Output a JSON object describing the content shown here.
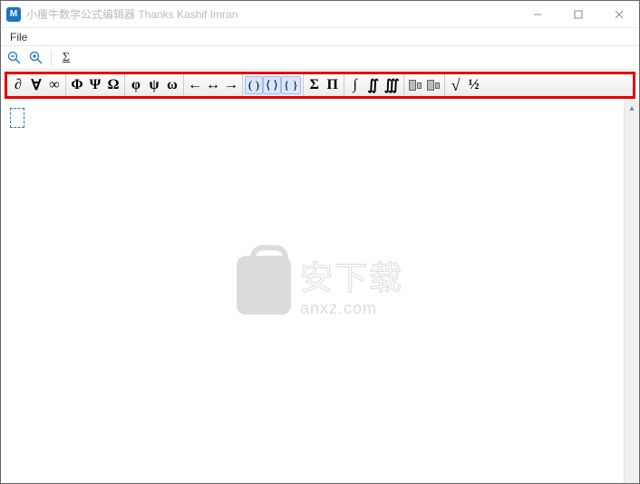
{
  "window": {
    "icon_letter": "M",
    "title": "小痩牛数学公式编辑器 Thanks Kashif Imran"
  },
  "menu": {
    "file": "File"
  },
  "toolbar": {
    "zoom_out": "zoom-out",
    "zoom_in": "zoom-in",
    "sigma_tool": "insert-sigma"
  },
  "symbols": {
    "group1": [
      "∂",
      "∀",
      "∞"
    ],
    "group2": [
      "Φ",
      "Ψ",
      "Ω"
    ],
    "group3": [
      "φ",
      "ψ",
      "ω"
    ],
    "group4": [
      "←",
      "↔",
      "→"
    ],
    "group5": [
      "( )",
      "⟨ ⟩",
      "{ }"
    ],
    "group6": [
      "Σ",
      "Π"
    ],
    "group7": [
      "∫",
      "∬",
      "∭"
    ],
    "group8_icons": [
      "matrix-box-1",
      "matrix-box-2"
    ],
    "group9": [
      "√",
      "½"
    ]
  },
  "watermark": {
    "cn": "安下载",
    "en": "anxz.com"
  }
}
